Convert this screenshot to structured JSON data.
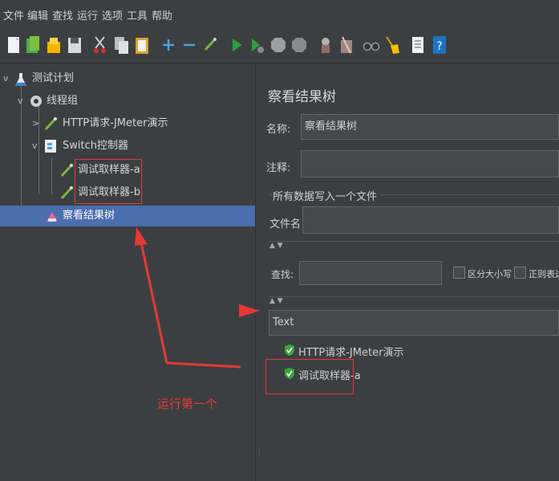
{
  "menu": [
    "文件",
    "编辑",
    "查找",
    "运行",
    "选项",
    "工具",
    "帮助"
  ],
  "toolbar": [
    "new-icon",
    "templates-icon",
    "open-icon",
    "save-icon",
    "cut-icon",
    "copy-icon",
    "paste-icon",
    "expand-icon",
    "collapse-icon",
    "toggle-icon",
    "start-icon",
    "start-no-pause-icon",
    "stop-icon",
    "shutdown-icon",
    "clear-icon",
    "clear-all-icon",
    "search-icon",
    "broom-icon",
    "function-helper-icon",
    "help-icon"
  ],
  "tree": {
    "test_plan": "测试计划",
    "thread_group": "线程组",
    "http_request": "HTTP请求-JMeter演示",
    "switch_controller": "Switch控制器",
    "debug_a": "调试取样器-a",
    "debug_b": "调试取样器-b",
    "results_tree": "察看结果树"
  },
  "panel": {
    "title": "察看结果树",
    "name_label": "名称:",
    "name_value": "察看结果树",
    "comment_label": "注释:",
    "file_section": "所有数据写入一个文件",
    "filename_label": "文件名",
    "search_label": "查找:",
    "case_sensitive": "区分大小写",
    "regex": "正则表达",
    "renderer": "Text",
    "results": [
      "HTTP请求-JMeter演示",
      "调试取样器-a"
    ]
  },
  "annotation": "运行第一个",
  "colors": {
    "selection": "#4b6eaf",
    "annotation": "#e53935",
    "success": "#3aa53a"
  }
}
